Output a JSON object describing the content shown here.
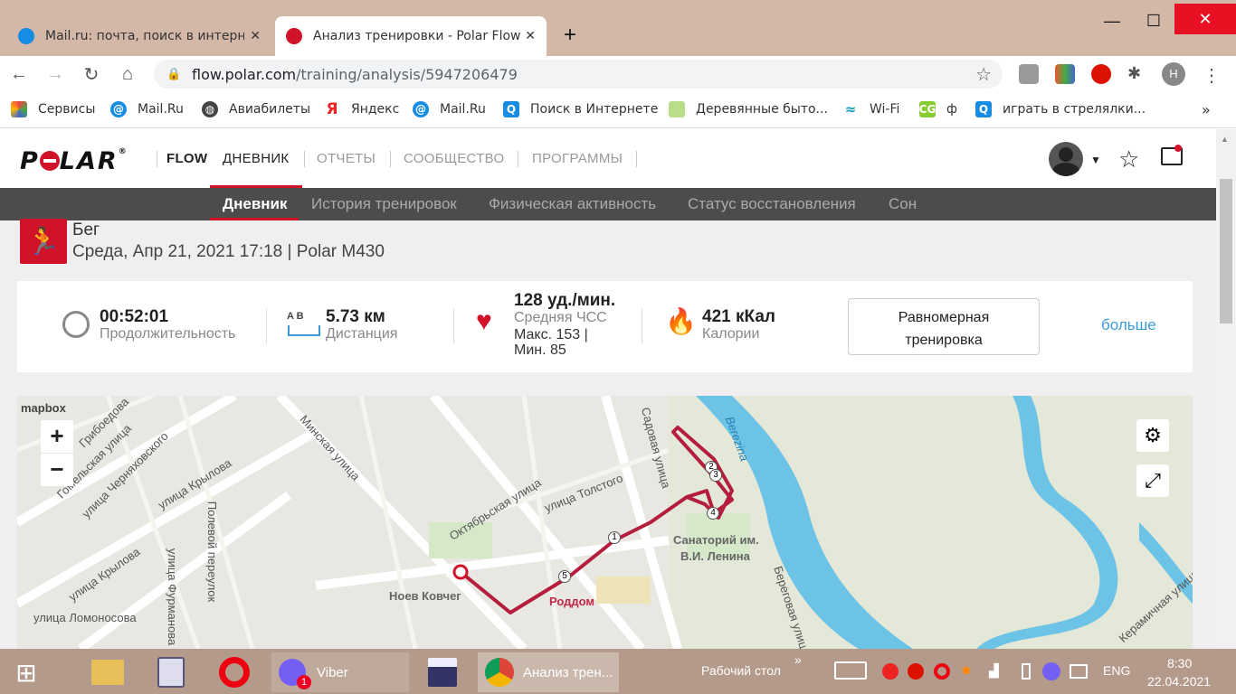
{
  "browser": {
    "tabs": [
      {
        "title": "Mail.ru: почта, поиск в интерне"
      },
      {
        "title": "Анализ тренировки - Polar Flow"
      }
    ],
    "url_host": "flow.polar.com",
    "url_path": "/training/analysis/5947206479",
    "profile_initial": "Н",
    "bookmarks": [
      "Сервисы",
      "Mail.Ru",
      "Авиабилеты",
      "Яндекс",
      "Mail.Ru",
      "Поиск в Интернете",
      "Деревянные быто...",
      "Wi-Fi",
      "ф",
      "играть в стрелялки..."
    ]
  },
  "polar": {
    "logo": "POLAR",
    "nav": [
      "FLOW",
      "ДНЕВНИК",
      "ОТЧЕТЫ",
      "СООБЩЕСТВО",
      "ПРОГРАММЫ"
    ],
    "subnav": [
      "Дневник",
      "История тренировок",
      "Физическая активность",
      "Статус восстановления",
      "Сон"
    ]
  },
  "workout": {
    "sport": "Бег",
    "datetime": "Среда, Апр 21, 2021 17:18 | Polar M430",
    "duration": "00:52:01",
    "duration_label": "Продолжительность",
    "distance_ab": "A  B",
    "distance": "5.73 км",
    "distance_label": "Дистанция",
    "hr_avg": "128 уд./мин.",
    "hr_label": "Средняя ЧСС",
    "hr_max": "Макс. 153  |",
    "hr_min": "Мин. 85",
    "calories": "421 кКал",
    "calories_label": "Калории",
    "benefit_line1": "Равномерная",
    "benefit_line2": "тренировка",
    "more": "больше"
  },
  "map": {
    "attribution": "mapbox",
    "labels": [
      "Минская улица",
      "улица Крылова",
      "улица Крылова",
      "Октябрьская улица",
      "улица Толстого",
      "Садовая улица",
      "Полевой переулок",
      "улица Фурманова",
      "Ноев Ковчег",
      "Роддом",
      "Санаторий им.",
      "В.И. Ленина",
      "Береговая улица",
      "Керамичная улица",
      "улица Ломоносова",
      "Berezina",
      "улица Черняховского",
      "Гомельская улица",
      "Грибоедова"
    ],
    "markers": [
      "1",
      "2",
      "3",
      "4",
      "5"
    ]
  },
  "taskbar": {
    "viber": "Viber",
    "viber_badge": "1",
    "chrome": "Анализ трен...",
    "desktop": "Рабочий стол",
    "lang": "ENG",
    "time": "8:30",
    "date": "22.04.2021"
  }
}
